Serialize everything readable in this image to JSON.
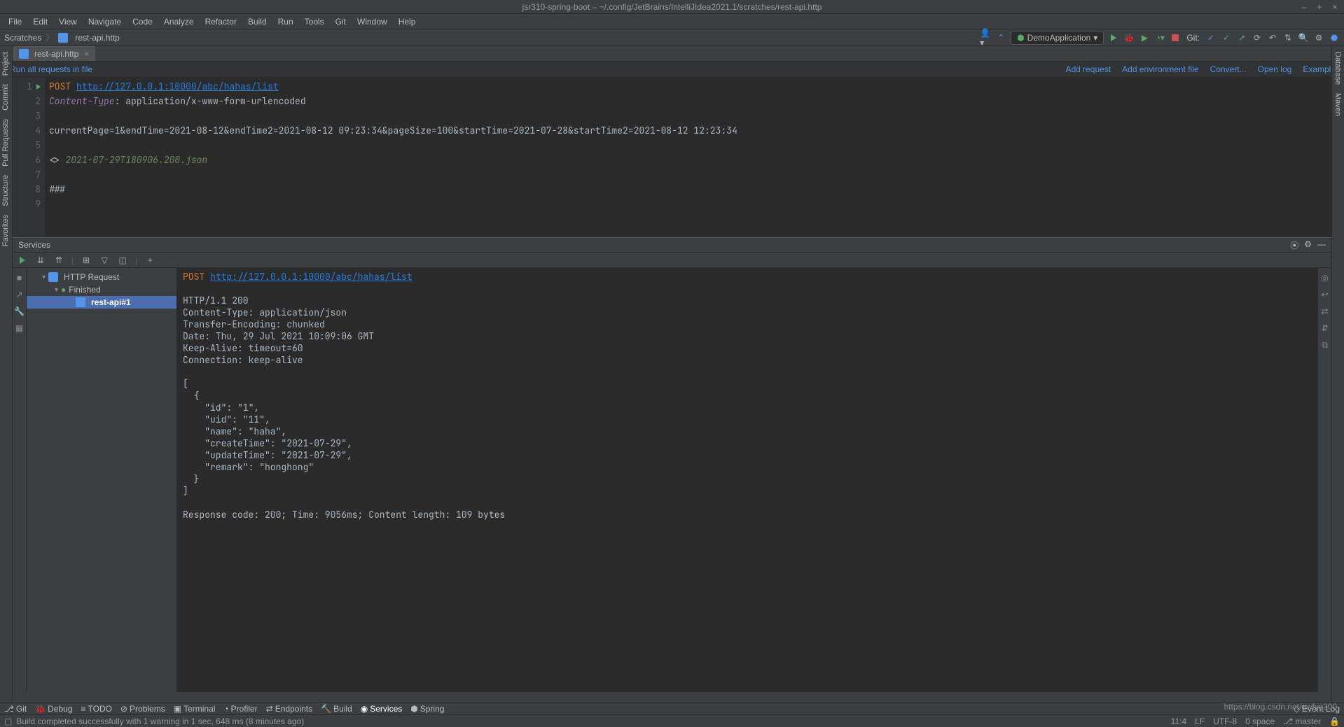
{
  "title": "jsr310-spring-boot – ~/.config/JetBrains/IntelliJIdea2021.1/scratches/rest-api.http",
  "menus": [
    "File",
    "Edit",
    "View",
    "Navigate",
    "Code",
    "Analyze",
    "Refactor",
    "Build",
    "Run",
    "Tools",
    "Git",
    "Window",
    "Help"
  ],
  "breadcrumb": {
    "root": "Scratches",
    "file": "rest-api.http"
  },
  "run_config": "DemoApplication",
  "git_label": "Git:",
  "file_tab": "rest-api.http",
  "editor_toolbar": {
    "run_all": "Run all requests in file",
    "links": [
      "Add request",
      "Add environment file",
      "Convert...",
      "Open log",
      "Examples"
    ]
  },
  "editor_lines": {
    "line_numbers": [
      "1",
      "2",
      "3",
      "4",
      "5",
      "6",
      "7",
      "8",
      "9"
    ],
    "method": "POST",
    "url": "http://127.0.0.1:10000/abc/hahas/list",
    "header_name": "Content-Type",
    "header_value": "application/x-www-form-urlencoded",
    "body": "currentPage=1&endTime=2021-08-12&endTime2=2021-08-12 09:23:34&pageSize=100&startTime=2021-07-28&startTime2=2021-08-12 12:23:34",
    "resp_marker": "<>",
    "resp_file": "2021-07-29T180906.200.json",
    "sep": "###"
  },
  "services": {
    "title": "Services",
    "tree": {
      "root": "HTTP Request",
      "finished": "Finished",
      "item": "rest-api#1"
    },
    "output": {
      "method": "POST",
      "url": "http://127.0.0.1:10000/abc/hahas/list",
      "status_line": "HTTP/1.1 200",
      "h1": "Content-Type: application/json",
      "h2": "Transfer-Encoding: chunked",
      "h3": "Date: Thu, 29 Jul 2021 10:09:06 GMT",
      "h4": "Keep-Alive: timeout=60",
      "h5": "Connection: keep-alive",
      "b1": "[",
      "b2": "  {",
      "b3": "    \"id\": \"1\",",
      "b4": "    \"uid\": \"11\",",
      "b5": "    \"name\": \"haha\",",
      "b6": "    \"createTime\": \"2021-07-29\",",
      "b7": "    \"updateTime\": \"2021-07-29\",",
      "b8": "    \"remark\": \"honghong\"",
      "b9": "  }",
      "b10": "]",
      "footer": "Response code: 200; Time: 9056ms; Content length: 109 bytes"
    }
  },
  "bottom_tools": [
    "Git",
    "Debug",
    "TODO",
    "Problems",
    "Terminal",
    "Profiler",
    "Endpoints",
    "Build",
    "Services",
    "Spring"
  ],
  "event_log": "Event Log",
  "status_msg": "Build completed successfully with 1 warning in 1 sec, 648 ms (8 minutes ago)",
  "status_right": {
    "pos": "11:4",
    "sep": "LF",
    "enc": "UTF-8",
    "ind": "0 space",
    "branch": "master"
  },
  "side_left": [
    "Project",
    "Commit",
    "Pull Requests",
    "Structure",
    "Favorites"
  ],
  "side_right": [
    "Database",
    "Maven"
  ],
  "watermark": "https://blog.csdn.net/qwfys200"
}
